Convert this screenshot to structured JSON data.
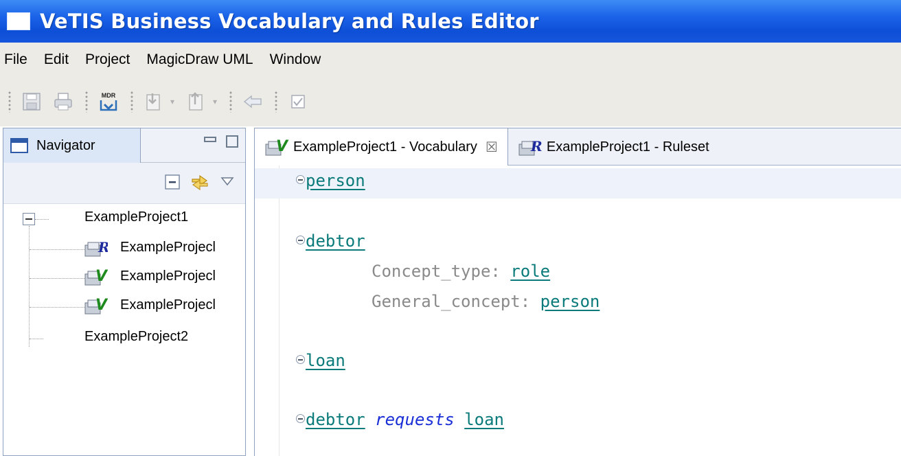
{
  "window": {
    "title": "VeTIS Business Vocabulary and Rules Editor"
  },
  "menu": [
    "File",
    "Edit",
    "Project",
    "MagicDraw UML",
    "Window"
  ],
  "toolbar": {
    "mdr_label": "MDR",
    "icons": [
      "save-icon",
      "print-icon",
      "mdr-import-icon",
      "next-annotation-icon",
      "previous-annotation-icon",
      "back-icon",
      "checkbox-icon"
    ]
  },
  "navigator": {
    "tab_label": "Navigator",
    "tree": {
      "project1": "ExampleProject1",
      "children": [
        "ExampleProjecl",
        "ExampleProjecl",
        "ExampleProjecl"
      ],
      "project2": "ExampleProject2"
    }
  },
  "editor": {
    "tabs": [
      {
        "label": "ExampleProject1 - Vocabulary",
        "close": "☒"
      },
      {
        "label": "ExampleProject1 - Ruleset"
      }
    ],
    "code": {
      "term1": "person",
      "term2": "debtor",
      "concept_type_key": "Concept_type:",
      "concept_type_val": "role",
      "general_concept_key": "General_concept:",
      "general_concept_val": "person",
      "term3": "loan",
      "fact_subject": "debtor",
      "fact_verb": "requests",
      "fact_object": "loan"
    }
  },
  "colors": {
    "titlebar": "#1a62e8",
    "chrome": "#ecebe6",
    "term": "#0a7a7a",
    "verb": "#1a2fd6",
    "keyword": "#8a8a8a"
  }
}
